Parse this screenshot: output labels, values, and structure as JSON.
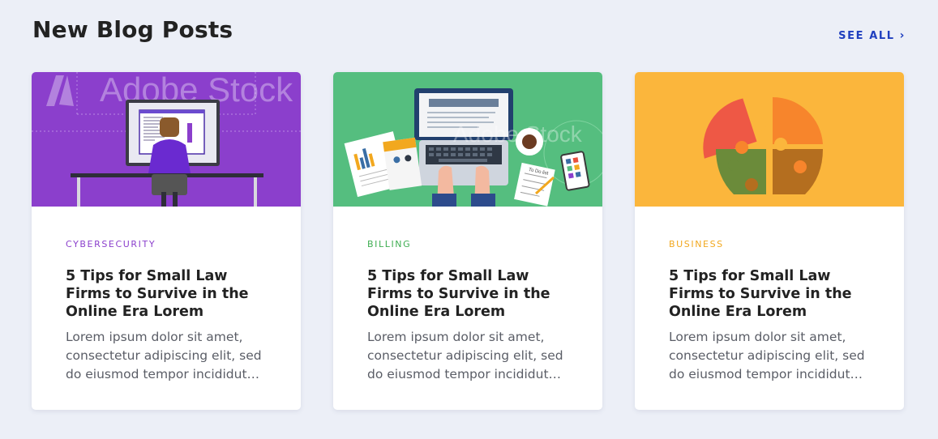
{
  "section": {
    "title": "New Blog Posts",
    "see_all_label": "SEE ALL",
    "see_all_chevron": "›"
  },
  "colors": {
    "cybersecurity": "#8b3fcc",
    "billing": "#3fae52",
    "business": "#f2a81f",
    "link": "#1f3fbf"
  },
  "watermark": "Adobe Stock",
  "posts": [
    {
      "category": "CYBERSECURITY",
      "category_color": "#8b3fcc",
      "title": "5 Tips for Small Law Firms to Survive in the Online Era Lorem",
      "excerpt": "Lorem ipsum dolor sit amet, consectetur adipiscing elit, sed do eiusmod tempor incididut…",
      "image": "person-at-computer-illustration"
    },
    {
      "category": "BILLING",
      "category_color": "#3fae52",
      "title": "5 Tips for Small Law Firms to Survive in the Online Era Lorem",
      "excerpt": "Lorem ipsum dolor sit amet, consectetur adipiscing elit, sed do eiusmod tempor incididut…",
      "image": "laptop-desk-illustration"
    },
    {
      "category": "BUSINESS",
      "category_color": "#f2a81f",
      "title": "5 Tips for Small Law Firms to Survive in the Online Era Lorem",
      "excerpt": "Lorem ipsum dolor sit amet, consectetur adipiscing elit, sed do eiusmod tempor incididut…",
      "image": "puzzle-lightbulb-illustration"
    }
  ]
}
